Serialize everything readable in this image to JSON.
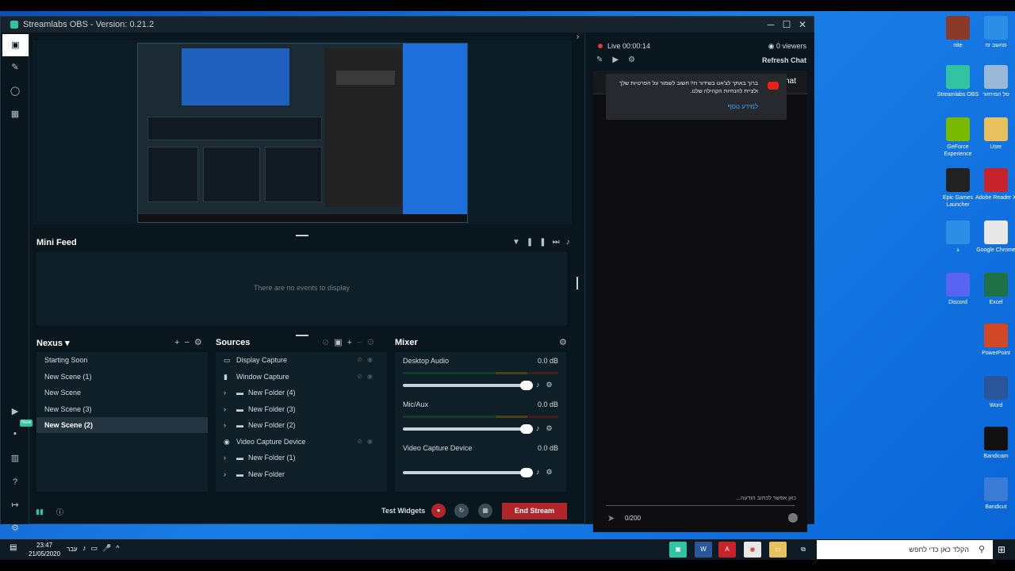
{
  "window": {
    "title": "Streamlabs OBS - Version: 0.21.2",
    "minimize": "─",
    "maximize": "☐",
    "close": "✕"
  },
  "nav": {
    "new_badge": "New"
  },
  "minifeed": {
    "title": "Mini Feed",
    "empty": "There are no events to display"
  },
  "scenes": {
    "title": "Nexus",
    "items": [
      "Starting Soon",
      "New Scene (1)",
      "New Scene",
      "New Scene (3)",
      "New Scene (2)"
    ],
    "selected_index": 4
  },
  "sources": {
    "title": "Sources",
    "items": [
      "Display Capture",
      "Window Capture",
      "New Folder (4)",
      "New Folder (3)",
      "New Folder (2)",
      "Video Capture Device",
      "New Folder (1)",
      "New Folder"
    ]
  },
  "mixer": {
    "title": "Mixer",
    "channels": [
      {
        "name": "Desktop Audio",
        "db": "0.0 dB"
      },
      {
        "name": "Mic/Aux",
        "db": "0.0 dB"
      },
      {
        "name": "Video Capture Device",
        "db": "0.0 dB"
      }
    ]
  },
  "footer": {
    "test_widgets": "Test Widgets",
    "end_stream": "End Stream"
  },
  "chat": {
    "live": "Live 00:00:14",
    "viewers": "0 viewers",
    "refresh": "Refresh Chat",
    "top_chat": "Top Chat",
    "message": "ברוך באתך לצ'אט בשידור חי! חשוב לשמור על הפרטיות שלך ולציית להנחיות הקהילה שלנו.",
    "learn_more": "למידע נוסף",
    "input_placeholder": "כאן אפשר לכתוב הודעה...",
    "counter": "0/200"
  },
  "desktop_icons": [
    {
      "label": "nite",
      "color": "#8a3a2a"
    },
    {
      "label": "מחשב זה",
      "color": "#2e8ee6"
    },
    {
      "label": "Streamlabs OBS",
      "color": "#31c3a2"
    },
    {
      "label": "סל המיחזור",
      "color": "#9ab8d8"
    },
    {
      "label": "GeForce Experience",
      "color": "#76b900"
    },
    {
      "label": "User",
      "color": "#e8c060"
    },
    {
      "label": "Epic Games Launcher",
      "color": "#222222"
    },
    {
      "label": "Adobe Reader X",
      "color": "#c8222a"
    },
    {
      "label": "ג",
      "color": "#2e8ee6"
    },
    {
      "label": "Google Chrome",
      "color": "#e8e8e8"
    },
    {
      "label": "Discord",
      "color": "#5865f2"
    },
    {
      "label": "Excel",
      "color": "#1e7145"
    },
    {
      "label": "PowerPoint",
      "color": "#d24726"
    },
    {
      "label": "Word",
      "color": "#2b579a"
    },
    {
      "label": "Bandicam",
      "color": "#111111"
    },
    {
      "label": "Bandicut",
      "color": "#3a7bd5"
    }
  ],
  "taskbar": {
    "time": "23:47",
    "date": "21/05/2020",
    "lang": "עבר",
    "search_placeholder": "הקלד כאן כדי לחפש"
  }
}
